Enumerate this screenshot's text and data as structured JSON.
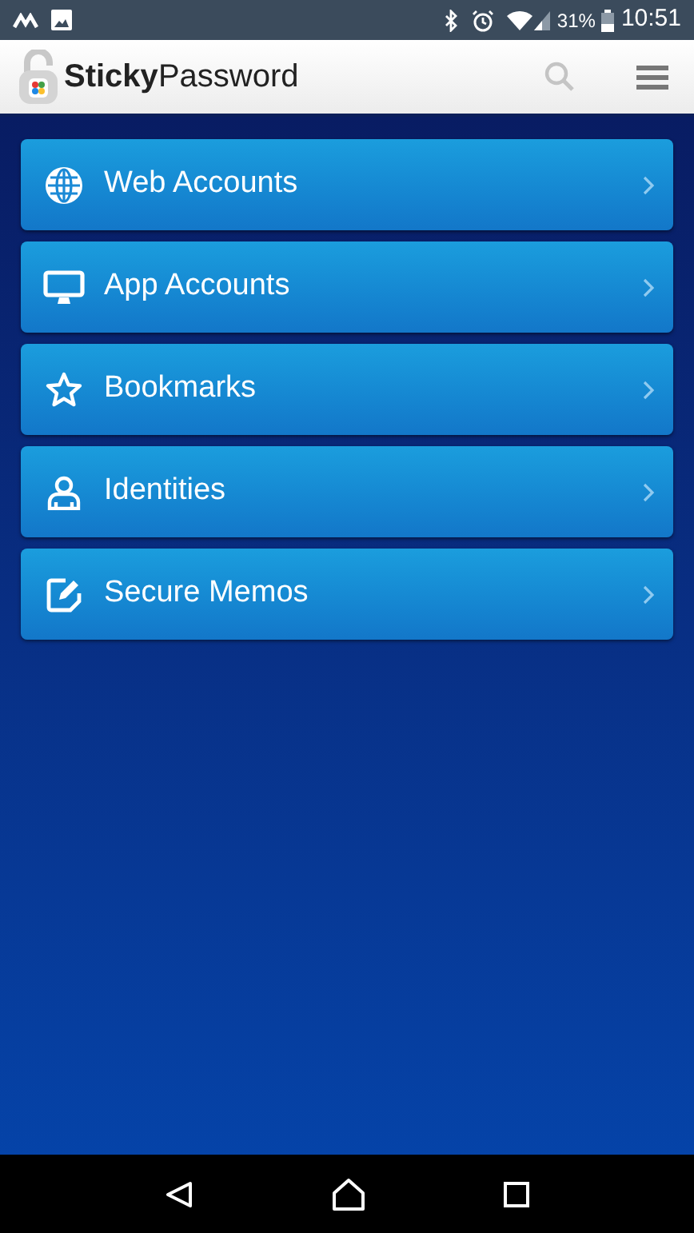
{
  "status_bar": {
    "battery": "31%",
    "time": "10:51"
  },
  "app_bar": {
    "title": "**Sticky**Password"
  },
  "menu": [
    {
      "label": "Web Accounts",
      "kind": "globe"
    },
    {
      "label": "App Accounts",
      "kind": "monitor"
    },
    {
      "label": "Bookmarks",
      "kind": "star"
    },
    {
      "label": "Identities",
      "kind": "person"
    },
    {
      "label": "Secure Memos",
      "kind": "memo"
    }
  ]
}
